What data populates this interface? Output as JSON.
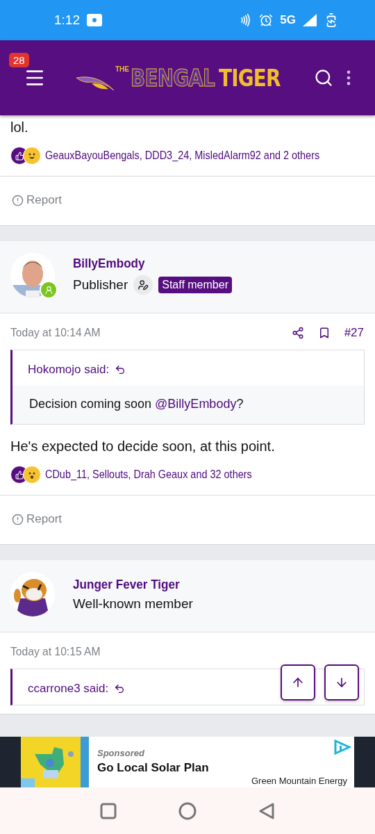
{
  "status_bar": {
    "time": "1:12",
    "network": "5G"
  },
  "header": {
    "notification_count": "28",
    "logo": {
      "small": "THE",
      "first": "BENGAL",
      "second": "TIGER"
    }
  },
  "posts": [
    {
      "body": "lol.",
      "reactions": {
        "emojis": [
          {
            "kind": "like"
          },
          {
            "kind": "laugh"
          }
        ],
        "text": "GeauxBayouBengals, DDD3_24, MisledAlarm92 and 2 others"
      },
      "report": "Report"
    },
    {
      "user": {
        "name": "BillyEmbody",
        "title": "Publisher",
        "staff_badge": "Staff member",
        "online": true
      },
      "date": "Today at 10:14 AM",
      "number": "#27",
      "quote": {
        "author": "Hokomojo said:",
        "text_before": "Decision coming soon ",
        "mention": "@BillyEmbody",
        "text_after": "?"
      },
      "body": "He's expected to decide soon, at this point.",
      "reactions": {
        "emojis": [
          {
            "kind": "like"
          },
          {
            "kind": "wow"
          }
        ],
        "text": "CDub_11, Sellouts, Drah Geaux and 32 others"
      },
      "report": "Report"
    },
    {
      "user": {
        "name": "Junger Fever Tiger",
        "title": "Well-known member",
        "online": false
      },
      "date": "Today at 10:15 AM",
      "quote": {
        "author": "ccarrone3 said:"
      }
    }
  ],
  "ad": {
    "label": "Sponsored",
    "title": "Go Local Solar Plan",
    "advertiser": "Green Mountain Energy"
  }
}
